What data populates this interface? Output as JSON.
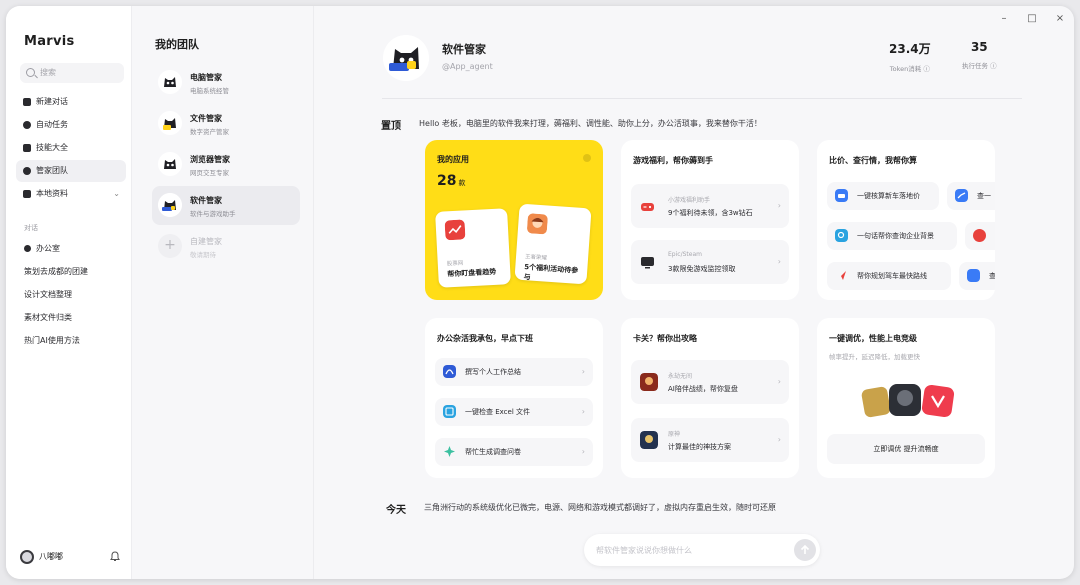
{
  "app": {
    "name": "Marvis"
  },
  "sidebar": {
    "search_placeholder": "搜索",
    "nav": [
      {
        "label": "新建对话",
        "icon": "new-chat-icon"
      },
      {
        "label": "自动任务",
        "icon": "clock-icon"
      },
      {
        "label": "技能大全",
        "icon": "wrench-icon"
      },
      {
        "label": "管家团队",
        "icon": "team-icon"
      },
      {
        "label": "本地资料",
        "icon": "folder-icon"
      }
    ],
    "section_label": "对话",
    "chats": [
      "办公室",
      "策划去成都的团建",
      "设计文档整理",
      "素材文件归类",
      "热门AI使用方法"
    ],
    "user_name": "八嘟嘟"
  },
  "team": {
    "title": "我的团队",
    "members": [
      {
        "name": "电脑管家",
        "desc": "电脑系统经管"
      },
      {
        "name": "文件管家",
        "desc": "数字资产管家"
      },
      {
        "name": "浏览器管家",
        "desc": "网页交互专家"
      },
      {
        "name": "软件管家",
        "desc": "软件与游戏助手"
      }
    ],
    "create": {
      "name": "自建管家",
      "desc": "敬请期待"
    }
  },
  "window": {
    "minimize": "–",
    "maximize": "□",
    "close": "×"
  },
  "profile": {
    "name": "软件管家",
    "handle": "@App_agent",
    "stats": [
      {
        "value": "23.4万",
        "label": "Token消耗 ⓘ"
      },
      {
        "value": "35",
        "label": "执行任务 ⓘ"
      }
    ]
  },
  "pinned": {
    "label": "置顶",
    "text": "Hello 老板，电脑里的软件我来打理，薅福利、调性能、助你上分，办公活琐事，我来替你干活！"
  },
  "cards": {
    "my_apps": {
      "title": "我的应用",
      "count": "28",
      "unit": "款",
      "tiles": [
        {
          "sub": "股票网",
          "text": "帮你盯盘看趋势"
        },
        {
          "sub": "王者荣耀",
          "text": "5个福利活动待参与"
        }
      ]
    },
    "game_welfare": {
      "title": "游戏福利，帮你薅到手",
      "rows": [
        {
          "sub": "小游戏福利助手",
          "text": "9个福利待未领，含3w钻石"
        },
        {
          "sub": "Epic/Steam",
          "text": "3款限免游戏监控领取"
        }
      ]
    },
    "compare": {
      "title": "比价、查行情，我帮你算",
      "rows": [
        "一键核算新车落地价",
        "查一",
        "一句话帮你查询企业背景",
        "帮你规划驾车最快路线",
        "查"
      ]
    },
    "office": {
      "title": "办公杂活我承包，早点下班",
      "rows": [
        "撰写个人工作总结",
        "一键检查 Excel 文件",
        "帮忙生成调查问卷"
      ]
    },
    "stuck": {
      "title": "卡关？帮你出攻略",
      "rows": [
        {
          "sub": "永劫无间",
          "text": "AI陪伴战绩，帮你复盘"
        },
        {
          "sub": "原神",
          "text": "计算最佳的神技方案"
        }
      ]
    },
    "tuning": {
      "title": "一键调优，性能上电竞级",
      "sub": "帧率提升，延迟降低，加载更快",
      "cta": "立即调优  提升流畅度"
    }
  },
  "today": {
    "label": "今天",
    "text": "三角洲行动的系统级优化已微完，电源、网络和游戏模式都调好了，虚拟内存重启生效，随时可还原"
  },
  "composer": {
    "placeholder": "帮软件管家说说你想做什么"
  }
}
